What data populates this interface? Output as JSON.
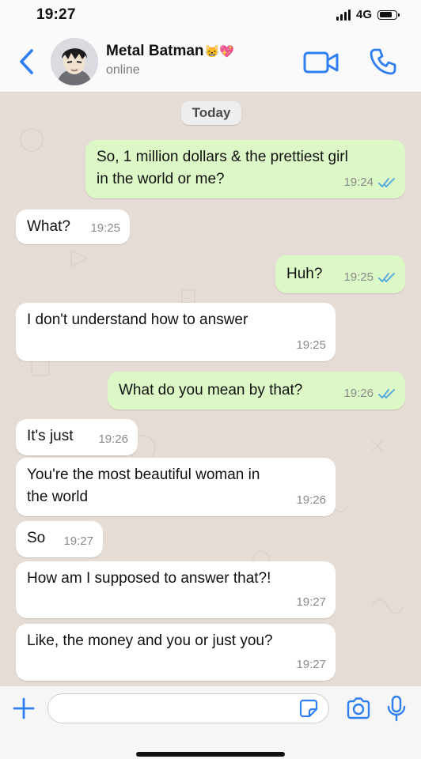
{
  "status_bar": {
    "time": "19:27",
    "network": "4G",
    "battery_level": 0.8,
    "signal_bars": 4
  },
  "header": {
    "contact_name": "Metal Batman",
    "name_emoji": "😸💖",
    "presence": "online",
    "back_icon": "chevron-left-icon",
    "video_icon": "video-camera-icon",
    "call_icon": "phone-icon",
    "accent_color": "#2f7ff0"
  },
  "chat": {
    "date_label": "Today",
    "messages": [
      {
        "direction": "out",
        "text_lines": [
          "So, 1 million dollars & the prettiest girl",
          "in the world or me?"
        ],
        "time": "19:24",
        "read": true
      },
      {
        "direction": "in",
        "text_lines": [
          "What?"
        ],
        "time": "19:25"
      },
      {
        "direction": "out",
        "text_lines": [
          "Huh?"
        ],
        "time": "19:25",
        "read": true
      },
      {
        "direction": "in",
        "text_lines": [
          "I don't understand how to answer"
        ],
        "time": "19:25"
      },
      {
        "direction": "out",
        "text_lines": [
          "What do you mean by that?"
        ],
        "time": "19:26",
        "read": true
      },
      {
        "direction": "in",
        "text_lines": [
          "It's just"
        ],
        "time": "19:26"
      },
      {
        "direction": "in",
        "text_lines": [
          "You're the most beautiful woman in",
          "the world"
        ],
        "time": "19:26"
      },
      {
        "direction": "in",
        "text_lines": [
          "So"
        ],
        "time": "19:27"
      },
      {
        "direction": "in",
        "text_lines": [
          "How am I supposed to answer that?!"
        ],
        "time": "19:27"
      },
      {
        "direction": "in",
        "text_lines": [
          "Like, the money and you or just you?"
        ],
        "time": "19:27"
      }
    ],
    "incoming_color": "#ffffff",
    "outgoing_color": "#dcf8c6",
    "read_tick_color": "#4fa3e0"
  },
  "input_bar": {
    "message_value": "",
    "icons": [
      "plus-icon",
      "sticker-icon",
      "camera-icon",
      "microphone-icon"
    ]
  }
}
